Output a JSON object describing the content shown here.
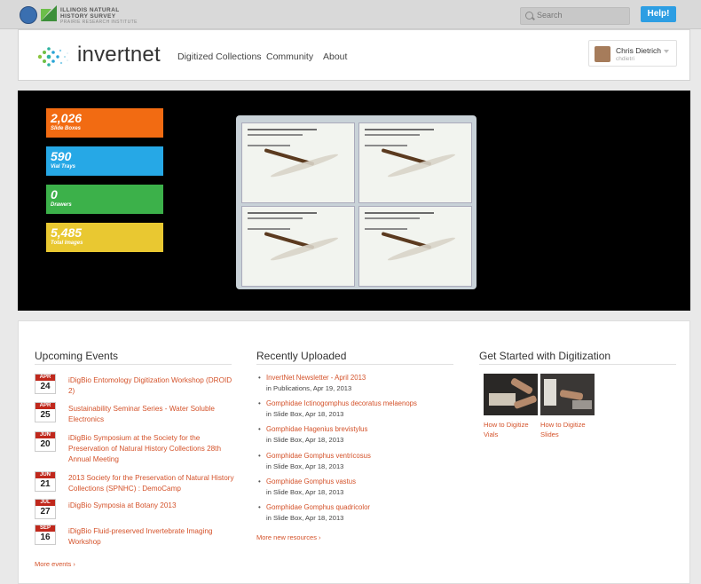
{
  "topbar": {
    "org_name_line1": "ILLINOIS NATURAL",
    "org_name_line2": "HISTORY SURVEY",
    "org_tagline": "PRAIRIE RESEARCH INSTITUTE",
    "search_placeholder": "Search",
    "help_label": "Help!"
  },
  "header": {
    "logo_text": "invertnet",
    "nav": [
      "Digitized Collections",
      "Community",
      "About"
    ],
    "user": {
      "name": "Chris Dietrich",
      "handle": "chdietri"
    }
  },
  "stats": [
    {
      "value": "2,026",
      "label": "Slide Boxes",
      "color": "#f26b12"
    },
    {
      "value": "590",
      "label": "Vial Trays",
      "color": "#26a8e6"
    },
    {
      "value": "0",
      "label": "Drawers",
      "color": "#3cb14a"
    },
    {
      "value": "5,485",
      "label": "Total Images",
      "color": "#e9c831"
    }
  ],
  "events": {
    "title": "Upcoming Events",
    "items": [
      {
        "month": "APR",
        "day": "24",
        "title": "iDigBio Entomology Digitization Workshop (DROID 2)"
      },
      {
        "month": "APR",
        "day": "25",
        "title": "Sustainability Seminar Series - Water Soluble Electronics"
      },
      {
        "month": "JUN",
        "day": "20",
        "title": "iDigBio Symposium at the Society for the Preservation of Natural History Collections 28th Annual Meeting"
      },
      {
        "month": "JUN",
        "day": "21",
        "title": "2013 Society for the Preservation of Natural History Collections (SPNHC) : DemoCamp"
      },
      {
        "month": "JUL",
        "day": "27",
        "title": "iDigBio Symposia at Botany 2013"
      },
      {
        "month": "SEP",
        "day": "16",
        "title": "iDigBio Fluid-preserved Invertebrate Imaging Workshop"
      }
    ],
    "more_label": "More events ›"
  },
  "uploads": {
    "title": "Recently Uploaded",
    "items": [
      {
        "title": "InvertNet Newsletter - April 2013",
        "meta": "in Publications, Apr 19, 2013"
      },
      {
        "title": "Gomphidae Ictinogomphus decoratus melaenops",
        "meta": "in Slide Box, Apr 18, 2013"
      },
      {
        "title": "Gomphidae Hagenius brevistylus",
        "meta": "in Slide Box, Apr 18, 2013"
      },
      {
        "title": "Gomphidae Gomphus ventricosus",
        "meta": "in Slide Box, Apr 18, 2013"
      },
      {
        "title": "Gomphidae Gomphus vastus",
        "meta": "in Slide Box, Apr 18, 2013"
      },
      {
        "title": "Gomphidae Gomphus quadricolor",
        "meta": "in Slide Box, Apr 18, 2013"
      }
    ],
    "more_label": "More new resources ›"
  },
  "get_started": {
    "title": "Get Started with Digitization",
    "links": [
      {
        "line1": "How to Digitize",
        "line2": "Vials"
      },
      {
        "line1": "How to Digitize",
        "line2": "Slides"
      }
    ]
  }
}
